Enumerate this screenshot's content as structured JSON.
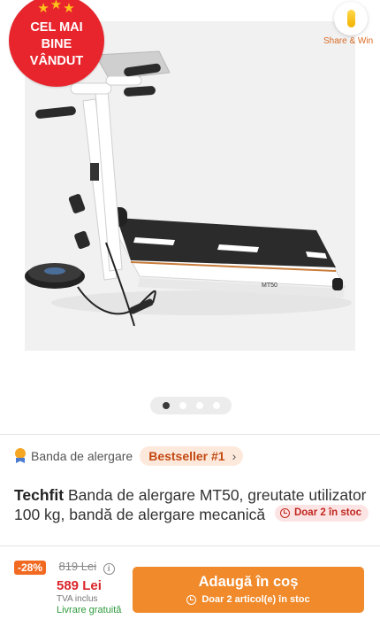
{
  "badge": {
    "line1": "CEL MAI",
    "line2": "BINE",
    "line3": "VÂNDUT"
  },
  "share": {
    "label": "Share & Win"
  },
  "gallery": {
    "image_alt": "Banda de alergare mecanica Techfit MT50",
    "product_label": "MT50",
    "dot_count": 4,
    "active_dot": 0
  },
  "breadcrumb": {
    "category": "Banda de alergare",
    "bestseller": "Bestseller #1"
  },
  "product": {
    "brand": "Techfit",
    "name": "Banda de alergare MT50, greutate utilizator 100 kg, bandă de alergare mecanică",
    "stock": "Doar 2 în stoc"
  },
  "pricing": {
    "discount": "-28%",
    "old_price": "819 Lei",
    "price": "589 Lei",
    "vat": "TVA inclus",
    "delivery": "Livrare gratuită"
  },
  "cart_button": {
    "label": "Adaugă în coș",
    "sub": "Doar 2 articol(e) în stoc"
  },
  "colors": {
    "accent": "#f08a2b",
    "badge": "#e8252d",
    "price": "#d9262b",
    "free": "#2d9a3b"
  }
}
